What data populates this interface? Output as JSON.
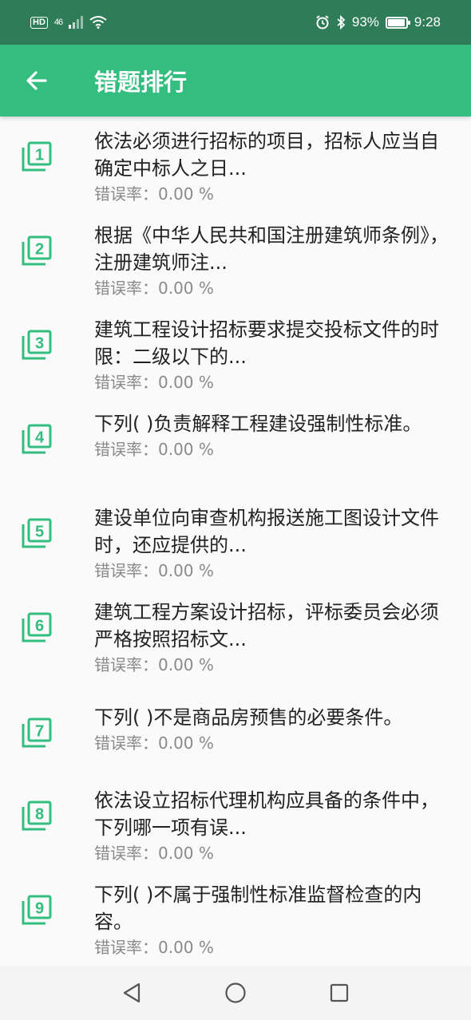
{
  "status_bar": {
    "network_hd": "HD",
    "network_type": "46",
    "battery_percent": "93%",
    "time": "9:28",
    "icons": [
      "hd-icon",
      "signal-icon",
      "wifi-icon",
      "alarm-icon",
      "bluetooth-icon",
      "battery-icon"
    ]
  },
  "app_bar": {
    "title": "错题排行",
    "back_icon": "arrow-left-icon"
  },
  "colors": {
    "status_bar": "#2e7d58",
    "app_bar": "#33bd7e",
    "accent_icon": "#33bd7e",
    "title_text": "#222222",
    "rate_text": "#8a8a8a"
  },
  "items": [
    {
      "rank": "1",
      "title": "依法必须进行招标的项目，招标人应当自确定中标人之日...",
      "rate": "错误率：0.00 %"
    },
    {
      "rank": "2",
      "title": "根据《中华人民共和国注册建筑师条例》，注册建筑师注...",
      "rate": "错误率：0.00 %"
    },
    {
      "rank": "3",
      "title": "建筑工程设计招标要求提交投标文件的时限：二级以下的...",
      "rate": "错误率：0.00 %"
    },
    {
      "rank": "4",
      "title": "下列(  )负责解释工程建设强制性标准。",
      "rate": "错误率：0.00 %"
    },
    {
      "rank": "5",
      "title": "建设单位向审查机构报送施工图设计文件时，还应提供的...",
      "rate": "错误率：0.00 %"
    },
    {
      "rank": "6",
      "title": "建筑工程方案设计招标，评标委员会必须严格按照招标文...",
      "rate": "错误率：0.00 %"
    },
    {
      "rank": "7",
      "title": "下列(  )不是商品房预售的必要条件。",
      "rate": "错误率：0.00 %"
    },
    {
      "rank": "8",
      "title": "依法设立招标代理机构应具备的条件中，下列哪一项有误...",
      "rate": "错误率：0.00 %"
    },
    {
      "rank": "9",
      "title": "下列(  )不属于强制性标准监督检查的内容。",
      "rate": "错误率：0.00 %"
    }
  ],
  "nav_bar": {
    "icons": [
      "back-triangle-icon",
      "home-circle-icon",
      "recents-square-icon"
    ]
  }
}
